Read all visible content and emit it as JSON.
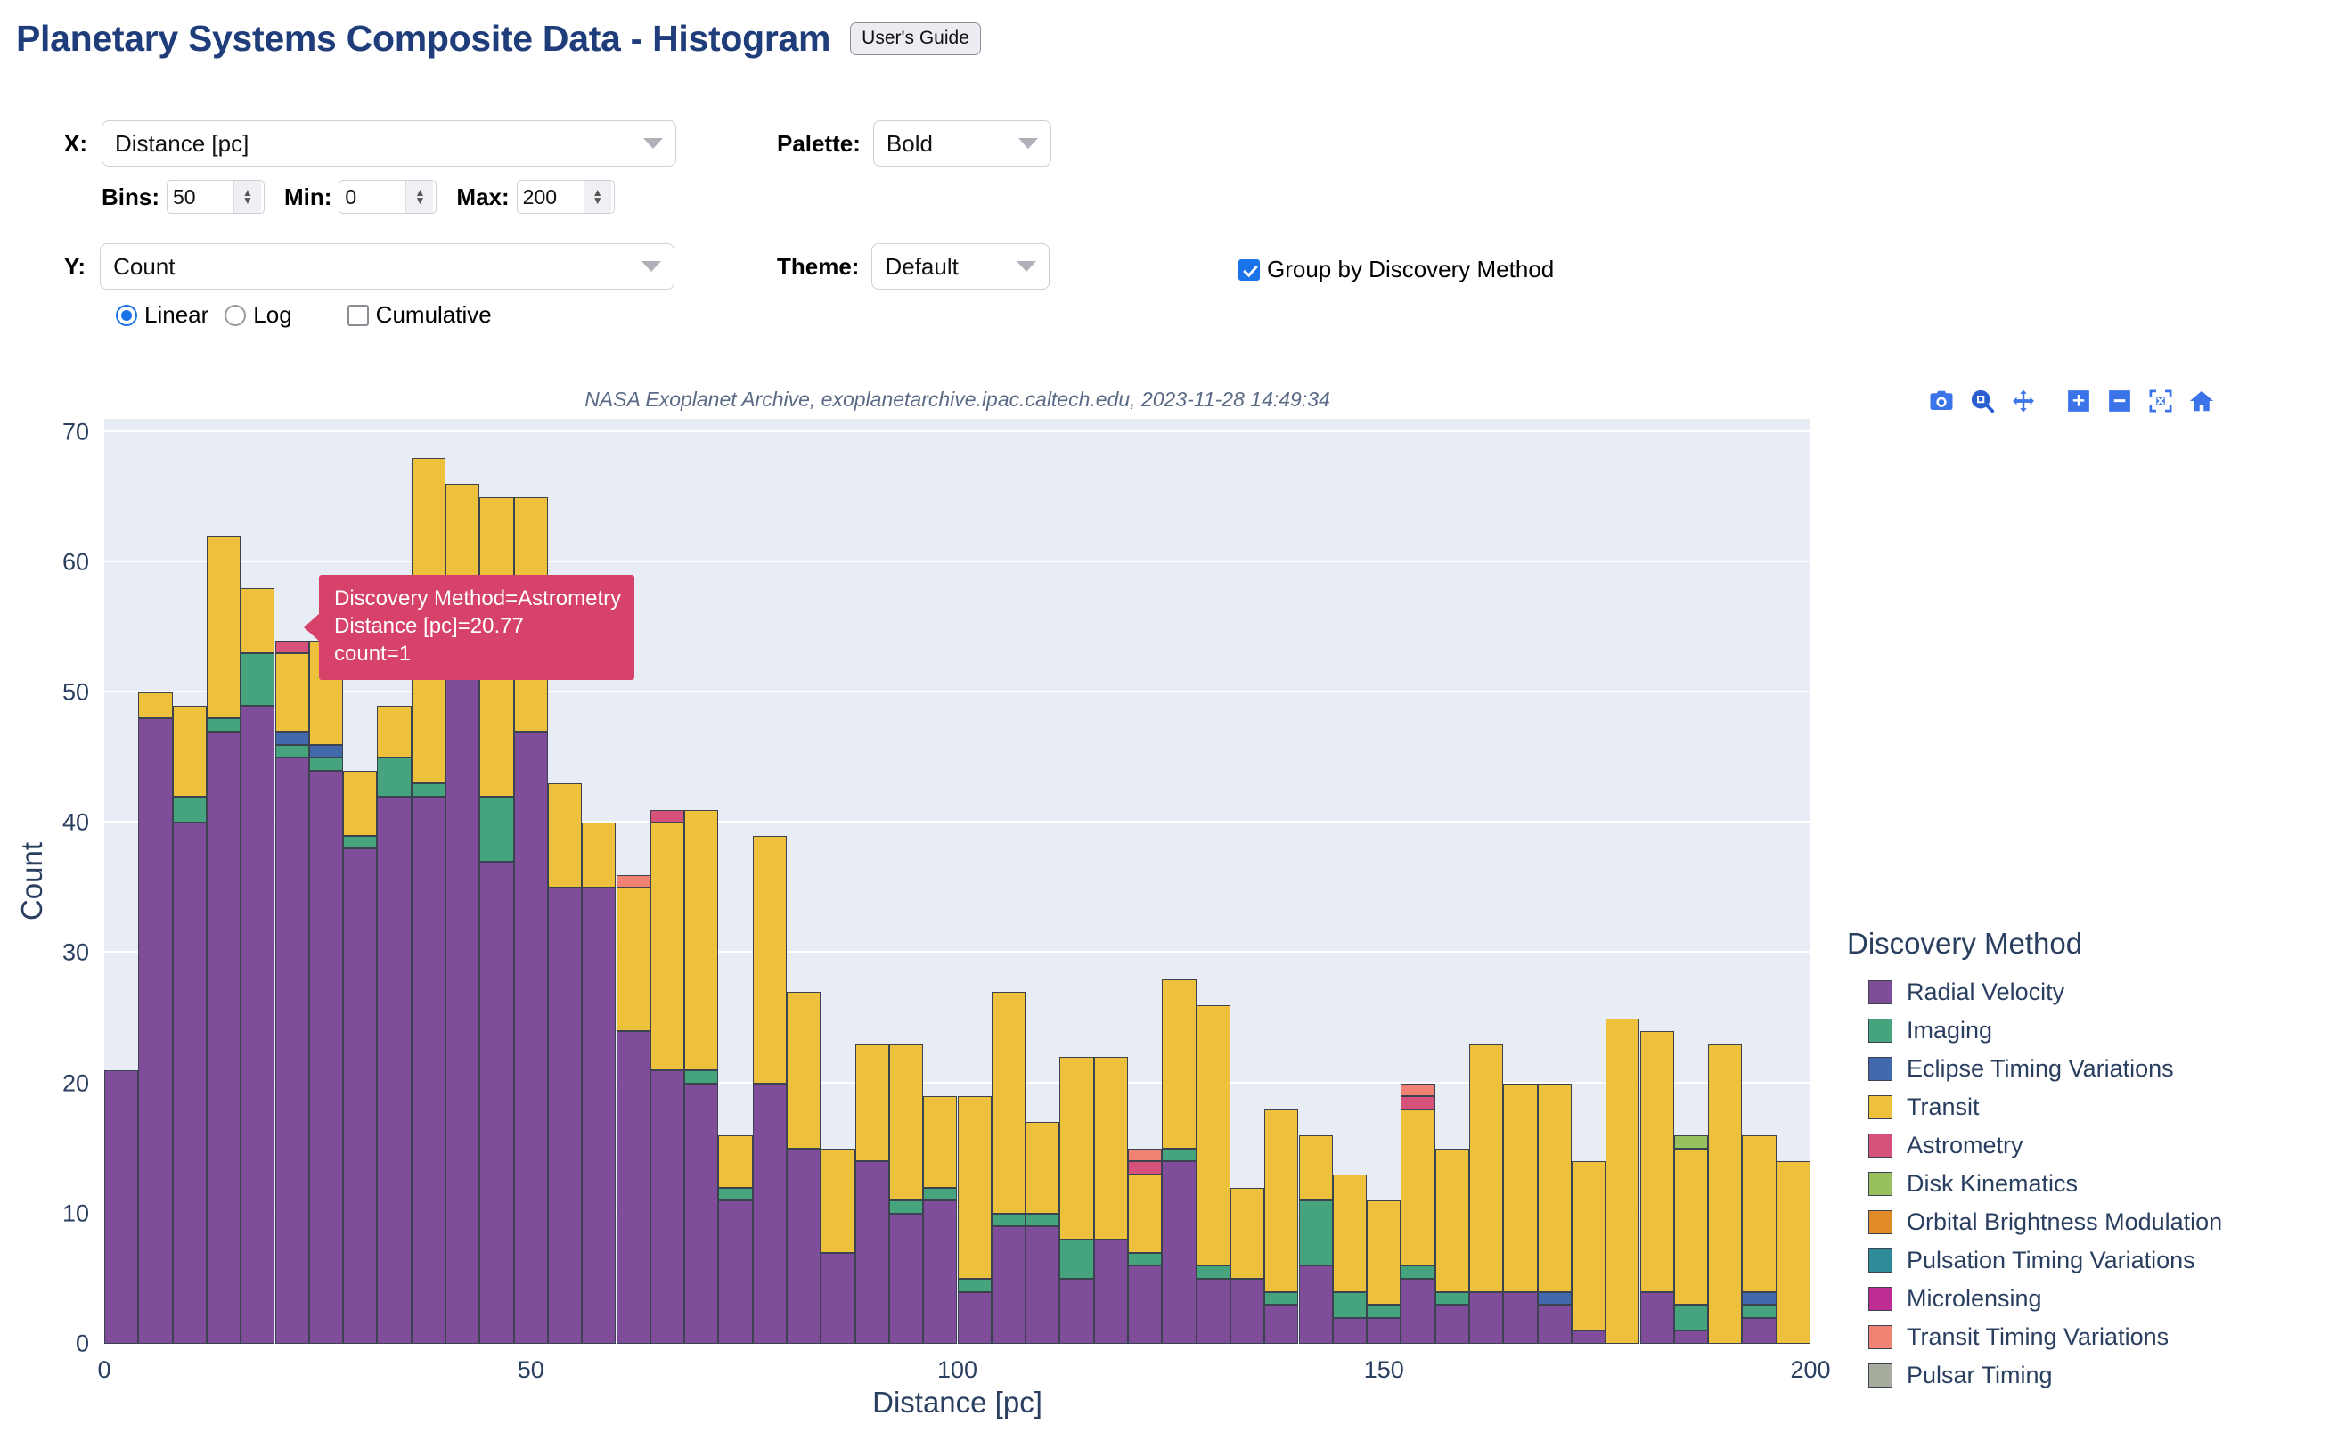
{
  "header": {
    "title": "Planetary Systems Composite Data - Histogram",
    "guide_button": "User's Guide"
  },
  "controls": {
    "x_label": "X:",
    "x_value": "Distance [pc]",
    "bins_label": "Bins:",
    "bins_value": "50",
    "min_label": "Min:",
    "min_value": "0",
    "max_label": "Max:",
    "max_value": "200",
    "y_label": "Y:",
    "y_value": "Count",
    "linear_label": "Linear",
    "log_label": "Log",
    "cumulative_label": "Cumulative",
    "linear_selected": true,
    "log_selected": false,
    "cumulative_checked": false,
    "palette_label": "Palette:",
    "palette_value": "Bold",
    "theme_label": "Theme:",
    "theme_value": "Default",
    "group_label": "Group by Discovery Method",
    "group_checked": true
  },
  "modebar": {
    "items": [
      {
        "name": "download-plot-icon",
        "title": "Download plot as a png"
      },
      {
        "name": "zoom-box-icon",
        "title": "Zoom"
      },
      {
        "name": "pan-icon",
        "title": "Pan"
      },
      {
        "name": "zoom-in-icon",
        "title": "Zoom in"
      },
      {
        "name": "zoom-out-icon",
        "title": "Zoom out"
      },
      {
        "name": "autoscale-icon",
        "title": "Autoscale"
      },
      {
        "name": "reset-axes-home-icon",
        "title": "Reset axes"
      }
    ]
  },
  "tooltip": {
    "line1": "Discovery Method=Astrometry",
    "line2": "Distance [pc]=20.77",
    "line3": "count=1",
    "bg_color": "#d6426a"
  },
  "legend": {
    "title": "Discovery Method",
    "items": [
      {
        "label": "Radial Velocity",
        "color": "#7f4d9a"
      },
      {
        "label": "Imaging",
        "color": "#45a37e"
      },
      {
        "label": "Eclipse Timing Variations",
        "color": "#4169ac"
      },
      {
        "label": "Transit",
        "color": "#eec13c"
      },
      {
        "label": "Astrometry",
        "color": "#d6527b"
      },
      {
        "label": "Disk Kinematics",
        "color": "#97c15e"
      },
      {
        "label": "Orbital Brightness Modulation",
        "color": "#e08b28"
      },
      {
        "label": "Pulsation Timing Variations",
        "color": "#2e8b98"
      },
      {
        "label": "Microlensing",
        "color": "#bf2d92"
      },
      {
        "label": "Transit Timing Variations",
        "color": "#f08274"
      },
      {
        "label": "Pulsar Timing",
        "color": "#a6ad9f"
      }
    ]
  },
  "chart_data": {
    "type": "bar",
    "barmode": "stacked",
    "title": "",
    "subtitle": "NASA Exoplanet Archive, exoplanetarchive.ipac.caltech.edu, 2023-11-28 14:49:34",
    "xlabel": "Distance [pc]",
    "ylabel": "Count",
    "xlim": [
      0,
      200
    ],
    "ylim": [
      0,
      71
    ],
    "xticks": [
      0,
      50,
      100,
      150,
      200
    ],
    "yticks": [
      0,
      10,
      20,
      30,
      40,
      50,
      60,
      70
    ],
    "grid": true,
    "legend_position": "right",
    "bin_width": 4,
    "bin_starts": [
      0,
      4,
      8,
      12,
      16,
      20,
      24,
      28,
      32,
      36,
      40,
      44,
      48,
      52,
      56,
      60,
      64,
      68,
      72,
      76,
      80,
      84,
      88,
      92,
      96,
      100,
      104,
      108,
      112,
      116,
      120,
      124,
      128,
      132,
      136,
      140,
      144,
      148,
      152,
      156,
      160,
      164,
      168,
      172,
      176,
      180,
      184,
      188,
      192,
      196
    ],
    "series": [
      {
        "name": "Radial Velocity",
        "color": "#7f4d9a",
        "values": [
          21,
          48,
          40,
          47,
          49,
          45,
          44,
          38,
          42,
          42,
          52,
          37,
          47,
          35,
          35,
          24,
          21,
          20,
          11,
          20,
          15,
          7,
          14,
          10,
          11,
          4,
          9,
          9,
          5,
          8,
          6,
          14,
          5,
          5,
          3,
          6,
          2,
          2,
          5,
          3,
          4,
          4,
          3,
          1,
          0,
          4,
          1,
          0,
          2,
          0
        ]
      },
      {
        "name": "Imaging",
        "color": "#45a37e",
        "values": [
          0,
          0,
          2,
          1,
          4,
          1,
          1,
          1,
          3,
          1,
          0,
          5,
          0,
          0,
          0,
          0,
          0,
          1,
          1,
          0,
          0,
          0,
          0,
          1,
          1,
          1,
          1,
          1,
          3,
          0,
          1,
          1,
          1,
          0,
          1,
          5,
          2,
          1,
          1,
          1,
          0,
          0,
          0,
          0,
          0,
          0,
          2,
          0,
          1,
          0
        ]
      },
      {
        "name": "Eclipse Timing Variations",
        "color": "#4169ac",
        "values": [
          0,
          0,
          0,
          0,
          0,
          1,
          1,
          0,
          0,
          0,
          0,
          0,
          0,
          0,
          0,
          0,
          0,
          0,
          0,
          0,
          0,
          0,
          0,
          0,
          0,
          0,
          0,
          0,
          0,
          0,
          0,
          0,
          0,
          0,
          0,
          0,
          0,
          0,
          0,
          0,
          0,
          0,
          1,
          0,
          0,
          0,
          0,
          0,
          1,
          0
        ]
      },
      {
        "name": "Transit",
        "color": "#eec13c",
        "values": [
          0,
          2,
          7,
          14,
          5,
          6,
          8,
          5,
          4,
          25,
          14,
          23,
          18,
          8,
          5,
          11,
          19,
          20,
          4,
          19,
          12,
          8,
          9,
          12,
          7,
          14,
          17,
          7,
          14,
          14,
          6,
          13,
          20,
          7,
          14,
          5,
          9,
          8,
          12,
          11,
          19,
          16,
          16,
          13,
          25,
          20,
          12,
          23,
          12,
          14
        ]
      },
      {
        "name": "Astrometry",
        "color": "#d6527b",
        "values": [
          0,
          0,
          0,
          0,
          0,
          1,
          0,
          0,
          0,
          0,
          0,
          0,
          0,
          0,
          0,
          0,
          1,
          0,
          0,
          0,
          0,
          0,
          0,
          0,
          0,
          0,
          0,
          0,
          0,
          0,
          1,
          0,
          0,
          0,
          0,
          0,
          0,
          0,
          1,
          0,
          0,
          0,
          0,
          0,
          0,
          0,
          0,
          0,
          0,
          0
        ]
      },
      {
        "name": "Disk Kinematics",
        "color": "#97c15e",
        "values": [
          0,
          0,
          0,
          0,
          0,
          0,
          0,
          0,
          0,
          0,
          0,
          0,
          0,
          0,
          0,
          0,
          0,
          0,
          0,
          0,
          0,
          0,
          0,
          0,
          0,
          0,
          0,
          0,
          0,
          0,
          0,
          0,
          0,
          0,
          0,
          0,
          0,
          0,
          0,
          0,
          0,
          0,
          0,
          0,
          0,
          0,
          1,
          0,
          0,
          0
        ]
      },
      {
        "name": "Orbital Brightness Modulation",
        "color": "#e08b28",
        "values": [
          0,
          0,
          0,
          0,
          0,
          0,
          0,
          0,
          0,
          0,
          0,
          0,
          0,
          0,
          0,
          0,
          0,
          0,
          0,
          0,
          0,
          0,
          0,
          0,
          0,
          0,
          0,
          0,
          0,
          0,
          0,
          0,
          0,
          0,
          0,
          0,
          0,
          0,
          0,
          0,
          0,
          0,
          0,
          0,
          0,
          0,
          0,
          0,
          0,
          0
        ]
      },
      {
        "name": "Pulsation Timing Variations",
        "color": "#2e8b98",
        "values": [
          0,
          0,
          0,
          0,
          0,
          0,
          0,
          0,
          0,
          0,
          0,
          0,
          0,
          0,
          0,
          0,
          0,
          0,
          0,
          0,
          0,
          0,
          0,
          0,
          0,
          0,
          0,
          0,
          0,
          0,
          0,
          0,
          0,
          0,
          0,
          0,
          0,
          0,
          0,
          0,
          0,
          0,
          0,
          0,
          0,
          0,
          0,
          0,
          0,
          0
        ]
      },
      {
        "name": "Microlensing",
        "color": "#bf2d92",
        "values": [
          0,
          0,
          0,
          0,
          0,
          0,
          0,
          0,
          0,
          0,
          0,
          0,
          0,
          0,
          0,
          0,
          0,
          0,
          0,
          0,
          0,
          0,
          0,
          0,
          0,
          0,
          0,
          0,
          0,
          0,
          0,
          0,
          0,
          0,
          0,
          0,
          0,
          0,
          0,
          0,
          0,
          0,
          0,
          0,
          0,
          0,
          0,
          0,
          0,
          0
        ]
      },
      {
        "name": "Transit Timing Variations",
        "color": "#f08274",
        "values": [
          0,
          0,
          0,
          0,
          0,
          0,
          0,
          0,
          0,
          0,
          0,
          0,
          0,
          0,
          0,
          1,
          0,
          0,
          0,
          0,
          0,
          0,
          0,
          0,
          0,
          0,
          0,
          0,
          0,
          0,
          1,
          0,
          0,
          0,
          0,
          0,
          0,
          0,
          1,
          0,
          0,
          0,
          0,
          0,
          0,
          0,
          0,
          0,
          0,
          0
        ]
      },
      {
        "name": "Pulsar Timing",
        "color": "#a6ad9f",
        "values": [
          0,
          0,
          0,
          0,
          0,
          0,
          0,
          0,
          0,
          0,
          0,
          0,
          0,
          0,
          0,
          0,
          0,
          0,
          0,
          0,
          0,
          0,
          0,
          0,
          0,
          0,
          0,
          0,
          0,
          0,
          0,
          0,
          0,
          0,
          0,
          0,
          0,
          0,
          0,
          0,
          0,
          0,
          0,
          0,
          0,
          0,
          0,
          0,
          0,
          0
        ]
      }
    ]
  }
}
